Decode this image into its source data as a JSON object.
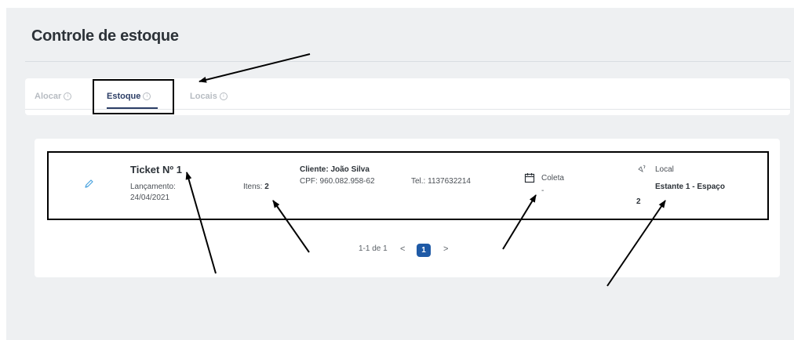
{
  "page": {
    "title": "Controle de estoque"
  },
  "tabs": [
    {
      "label": "Alocar",
      "active": false,
      "icon": "info-icon"
    },
    {
      "label": "Estoque",
      "active": true,
      "icon": "info-icon"
    },
    {
      "label": "Locais",
      "active": false,
      "icon": "info-icon"
    }
  ],
  "ticket": {
    "title": "Ticket Nº 1",
    "launch_label": "Lançamento:",
    "launch_date": "24/04/2021",
    "items_label": "Itens:",
    "items_value": "2",
    "client": "Cliente: João Silva",
    "cpf": "CPF: 960.082.958-62",
    "phone": "Tel.: 1137632214",
    "pickup_label": "Coleta",
    "pickup_value": "-",
    "location_label": "Local",
    "location_value": "Estante 1 - Espaço",
    "location_number": "2"
  },
  "pagination": {
    "range": "1-1 de 1",
    "prev": "<",
    "current": "1",
    "next": ">"
  },
  "colors": {
    "accent": "#1f5aa6",
    "active_tab": "#2c3e66",
    "background": "#eef0f2",
    "edit_icon": "#4aa3df"
  },
  "icons": {
    "edit": "pencil-icon",
    "pickup": "calendar-icon",
    "location": "location-icon"
  }
}
